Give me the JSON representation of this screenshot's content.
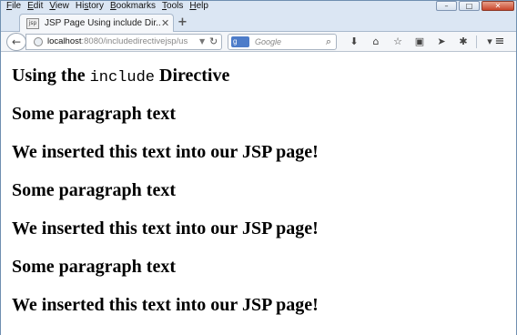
{
  "menu": {
    "items": [
      {
        "pre": "",
        "ul": "F",
        "post": "ile"
      },
      {
        "pre": "",
        "ul": "E",
        "post": "dit"
      },
      {
        "pre": "",
        "ul": "V",
        "post": "iew"
      },
      {
        "pre": "Hi",
        "ul": "s",
        "post": "tory"
      },
      {
        "pre": "",
        "ul": "B",
        "post": "ookmarks"
      },
      {
        "pre": "",
        "ul": "T",
        "post": "ools"
      },
      {
        "pre": "",
        "ul": "H",
        "post": "elp"
      }
    ]
  },
  "window": {
    "minimize": "–",
    "maximize": "□",
    "close": "✕"
  },
  "tab": {
    "title": "JSP Page Using include Dir...",
    "close": "✕",
    "favicon": "jsp"
  },
  "newtab": "+",
  "nav": {
    "back": "←",
    "url_host": "localhost",
    "url_rest": ":8080/includedirectivejsp/us",
    "dropdown": "▼",
    "reload": "↻"
  },
  "search": {
    "engine": "g",
    "placeholder": "Google",
    "go": "⌕"
  },
  "toolbar": {
    "icons": [
      {
        "name": "download-icon",
        "glyph": "⬇"
      },
      {
        "name": "home-icon",
        "glyph": "⌂"
      },
      {
        "name": "bookmark-star-icon",
        "glyph": "☆"
      },
      {
        "name": "clipboard-icon",
        "glyph": "▣"
      },
      {
        "name": "send-icon",
        "glyph": "➤"
      },
      {
        "name": "addon-icon",
        "glyph": "✱"
      },
      {
        "name": "dropdown-arrow-icon",
        "glyph": "▾"
      }
    ],
    "menu": "≡"
  },
  "page": {
    "heading_pre": "Using the ",
    "heading_code": "include",
    "heading_post": " Directive",
    "lines": [
      "Some paragraph text",
      "We inserted this text into our JSP page!",
      "Some paragraph text",
      "We inserted this text into our JSP page!",
      "Some paragraph text",
      "We inserted this text into our JSP page!"
    ]
  }
}
